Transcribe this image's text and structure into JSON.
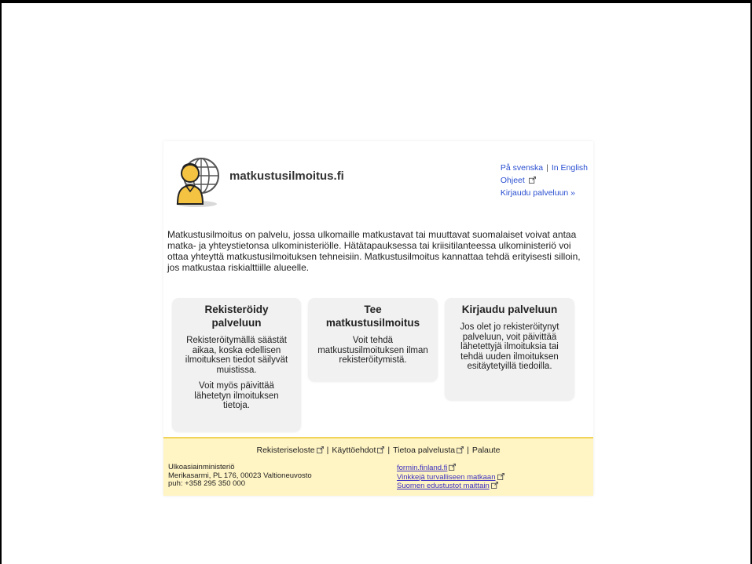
{
  "brand": {
    "name": "matkustusilmoitus.fi"
  },
  "top_links": {
    "swedish": "På svenska",
    "separator": "|",
    "english": "In English",
    "help": "Ohjeet",
    "login": "Kirjaudu palveluun »"
  },
  "intro": "Matkustusilmoitus on palvelu, jossa ulkomaille matkustavat tai muuttavat suomalaiset voivat antaa matka- ja yhteystietonsa ulkoministeriölle. Hätätapauksessa tai kriisitilanteessa ulkoministeriö voi ottaa yhteyttä matkustusilmoituksen tehneisiin. Matkustusilmoitus kannattaa tehdä erityisesti silloin, jos matkustaa riskialttiille alueelle.",
  "cards": [
    {
      "title": "Rekisteröidy palveluun",
      "texts": [
        "Rekisteröitymällä säästät aikaa, koska edellisen ilmoituksen tiedot säilyvät muistissa.",
        "Voit myös päivittää lähetetyn ilmoituksen tietoja."
      ]
    },
    {
      "title": "Tee matkustusilmoitus",
      "texts": [
        "Voit tehdä matkustusilmoituksen ilman rekisteröitymistä."
      ]
    },
    {
      "title": "Kirjaudu palveluun",
      "texts": [
        "Jos olet jo rekisteröitynyt palveluun, voit päivittää lähetettyjä ilmoituksia tai tehdä uuden ilmoituksen esitäytetyillä tiedoilla."
      ]
    }
  ],
  "footer": {
    "links": [
      "Rekisteriseloste",
      "Käyttöehdot",
      "Tietoa palvelusta",
      "Palaute"
    ],
    "separator": "|",
    "org": {
      "name": "Ulkoasiainministeriö",
      "address": "Merikasarmi, PL 176, 00023 Valtioneuvosto",
      "phone": "puh: +358 295 350 000"
    },
    "ext_links": [
      "formin.finland.fi",
      "Vinkkejä turvalliseen matkaan",
      "Suomen edustustot maittain"
    ]
  },
  "colors": {
    "link": "#2a4fd0",
    "footer_bg": "#fff4c4",
    "footer_border": "#f2d35a",
    "card_bg": "#f1f1f1",
    "logo_figure": "#f5c342"
  }
}
